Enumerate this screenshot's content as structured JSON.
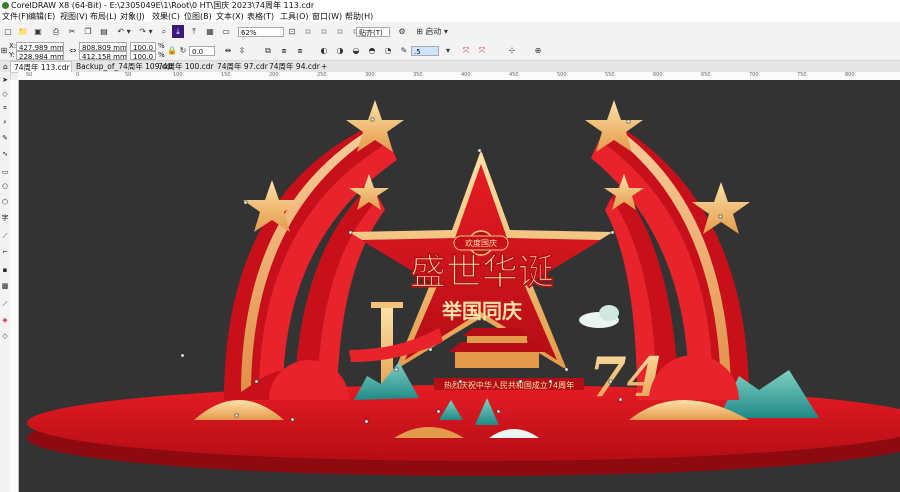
{
  "window": {
    "title": "CorelDRAW X8 (64-Bit) - E:\\2305049E\\1\\Root\\0 HT\\国庆 2023\\74周年 113.cdr"
  },
  "menu": [
    "文件(F)",
    "编辑(E)",
    "视图(V)",
    "布局(L)",
    "对象(J)",
    "效果(C)",
    "位图(B)",
    "文本(X)",
    "表格(T)",
    "工具(O)",
    "窗口(W)",
    "帮助(H)"
  ],
  "toolbar": {
    "zoom_value": "62%",
    "snap_label": "贴齐(T)",
    "launch_label": "启动"
  },
  "property_bar": {
    "x_label": "X:",
    "x_value": "427.989 mm",
    "y_label": "Y:",
    "y_value": "228.984 mm",
    "w_value": "808.809 mm",
    "h_value": "412.158 mm",
    "scale_x": "100.0",
    "scale_y": "100.0",
    "pct": "%",
    "rotation": "0.0",
    "outline_width": ".5"
  },
  "tabs": [
    {
      "label": "74周年 113.cdr"
    },
    {
      "label": "Backup_of_74周年 109.cdr"
    },
    {
      "label": "74周年 100.cdr"
    },
    {
      "label": "74周年 97.cdr"
    },
    {
      "label": "74周年 94.cdr"
    }
  ],
  "ruler": {
    "ticks": [
      "50",
      "0",
      "50",
      "100",
      "150",
      "200",
      "250",
      "300",
      "350",
      "400",
      "450",
      "500",
      "550",
      "600",
      "650",
      "700",
      "750",
      "800"
    ]
  },
  "artwork": {
    "title": "盛世华诞",
    "subtitle": "举国同庆",
    "badge": "欢度国庆",
    "banner": "热烈庆祝中华人民共和国成立74周年",
    "big_number": "74",
    "colors": {
      "red": "#d4111b",
      "dark_red": "#a10912",
      "gold": "#f4c27a",
      "teal": "#1f8a86",
      "canvas": "#333333"
    }
  },
  "tools": [
    "pointer-icon",
    "node-icon",
    "crop-icon",
    "zoom-icon",
    "freehand-icon",
    "curve-icon",
    "rectangle-icon",
    "ellipse-icon",
    "polygon-icon",
    "text-icon",
    "parallel-dim-icon",
    "connector-icon",
    "shadow-icon",
    "transparency-icon",
    "eyedropper-icon",
    "fill-icon",
    "outline-icon"
  ]
}
